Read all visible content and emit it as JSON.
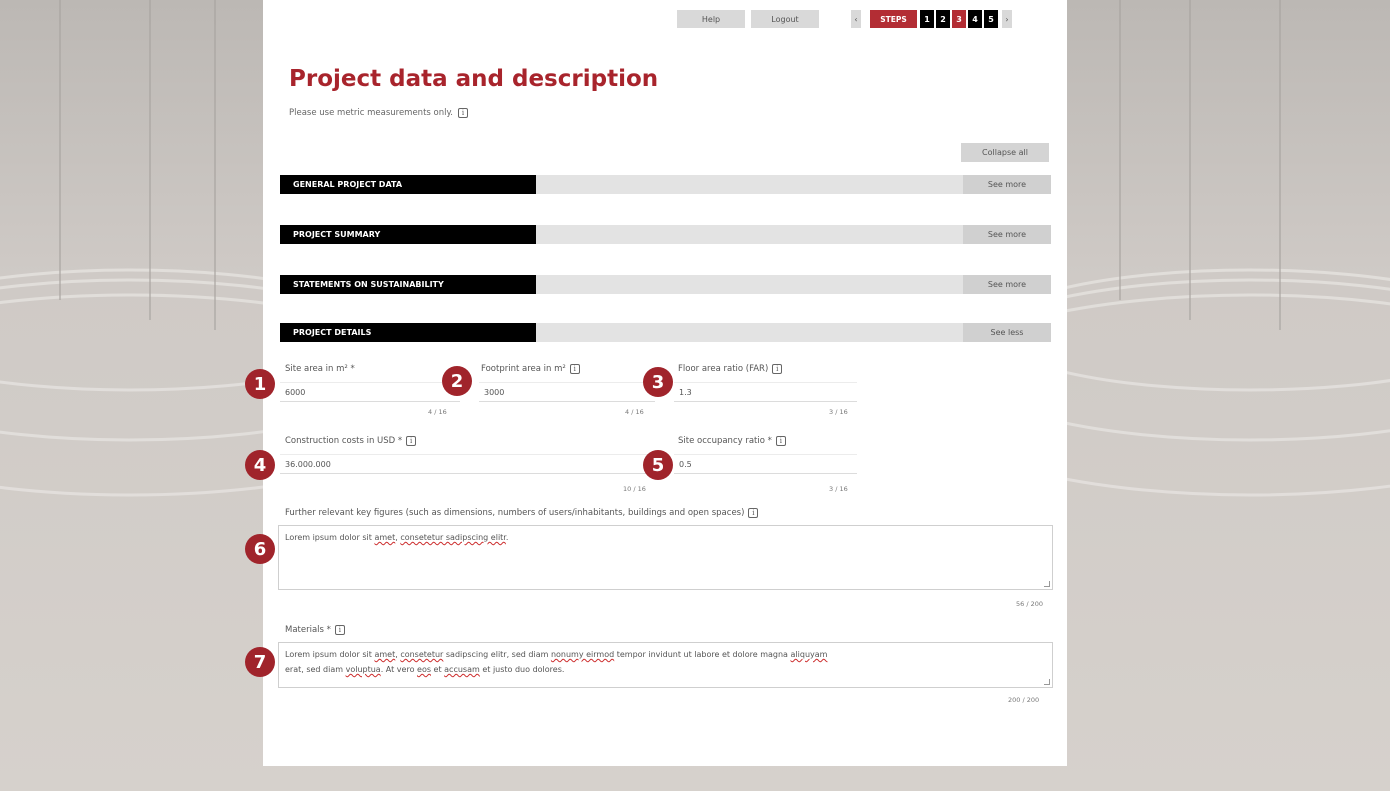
{
  "topbar": {
    "help_label": "Help",
    "logout_label": "Logout",
    "prev_arrow": "‹",
    "next_arrow": "›",
    "steps_label": "STEPS",
    "steps": [
      "1",
      "2",
      "3",
      "4",
      "5"
    ],
    "active_step": "3",
    "colors": {
      "accent": "#b32d34",
      "step_bg": "#000000"
    }
  },
  "page": {
    "title": "Project data and description",
    "subtitle": "Please use metric measurements only.",
    "info_glyph": "i",
    "collapse_all_label": "Collapse all"
  },
  "sections": [
    {
      "label": "GENERAL PROJECT DATA",
      "button": "See more"
    },
    {
      "label": "PROJECT SUMMARY",
      "button": "See more"
    },
    {
      "label": "STATEMENTS ON SUSTAINABILITY",
      "button": "See more"
    },
    {
      "label": "PROJECT DETAILS",
      "button": "See less"
    }
  ],
  "fields": {
    "site_area": {
      "label": "Site area in m² *",
      "value": "6000",
      "counter": "4 / 16",
      "badge": "1"
    },
    "footprint": {
      "label": "Footprint area in m²",
      "value": "3000",
      "counter": "4 / 16",
      "badge": "2"
    },
    "far": {
      "label": "Floor area ratio (FAR)",
      "value": "1.3",
      "counter": "3 / 16",
      "badge": "3"
    },
    "construction_costs": {
      "label": "Construction costs in USD *",
      "value": "36.000.000",
      "counter": "10 / 16",
      "badge": "4"
    },
    "site_occupancy": {
      "label": "Site occupancy ratio *",
      "value": "0.5",
      "counter": "3 / 16",
      "badge": "5"
    },
    "key_figures": {
      "label": "Further relevant key figures (such as dimensions, numbers of users/inhabitants, buildings and open spaces)",
      "value_plain": "Lorem ipsum dolor sit ",
      "value_sq1": "amet",
      "value_mid": ", ",
      "value_sq2": "consetetur sadipscing elitr",
      "value_end": ".",
      "counter": "56 / 200",
      "badge": "6"
    },
    "materials": {
      "label": "Materials *",
      "line1_a": "Lorem ipsum dolor sit ",
      "line1_b": "amet",
      "line1_c": ", ",
      "line1_d": "consetetur",
      "line1_e": " sadipscing elitr, sed diam ",
      "line1_f": "nonumy eirmod",
      "line1_g": " tempor invidunt ut labore et dolore magna ",
      "line1_h": "aliquyam",
      "line2_a": "erat, sed diam ",
      "line2_b": "voluptua",
      "line2_c": ". At vero ",
      "line2_d": "eos",
      "line2_e": " et ",
      "line2_f": "accusam",
      "line2_g": " et justo duo dolores.",
      "counter": "200 / 200",
      "badge": "7"
    }
  }
}
